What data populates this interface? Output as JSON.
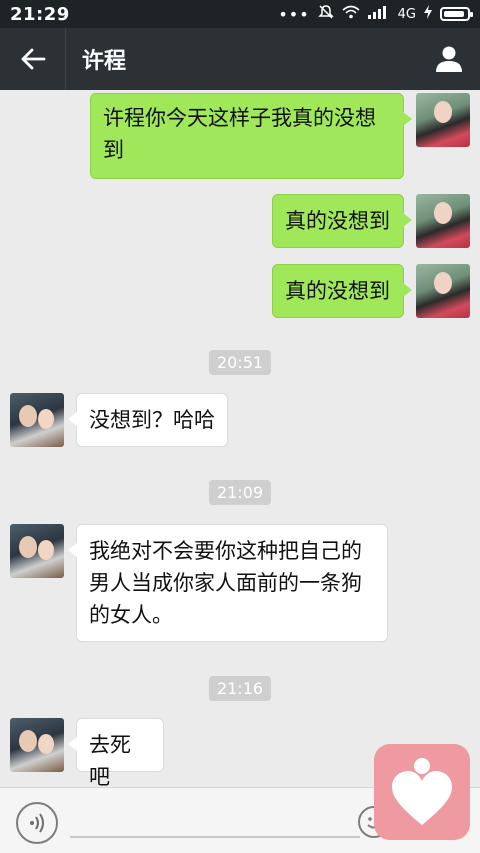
{
  "status_bar": {
    "time": "21:29",
    "dots": "•••",
    "carrier": "4G"
  },
  "header": {
    "title": "许程"
  },
  "messages": [
    {
      "side": "out",
      "text": "许程你今天这样子我真的没想到"
    },
    {
      "side": "out",
      "text": "真的没想到"
    },
    {
      "side": "out",
      "text": "真的没想到"
    },
    {
      "type": "time",
      "text": "20:51"
    },
    {
      "side": "in",
      "text": "没想到？哈哈"
    },
    {
      "type": "time",
      "text": "21:09"
    },
    {
      "side": "in",
      "text": "我绝对不会要你这种把自己的男人当成你家人面前的一条狗的女人。"
    },
    {
      "type": "time",
      "text": "21:16"
    },
    {
      "side": "in",
      "text": "去死吧"
    }
  ],
  "colors": {
    "outgoing_bubble": "#a0e75a",
    "incoming_bubble": "#ffffff",
    "header_bg": "#2c3136",
    "badge_bg": "#ef9aa0"
  },
  "icons": [
    "back-arrow-icon",
    "profile-icon",
    "voice-icon",
    "emoji-icon",
    "heart-app-icon"
  ]
}
